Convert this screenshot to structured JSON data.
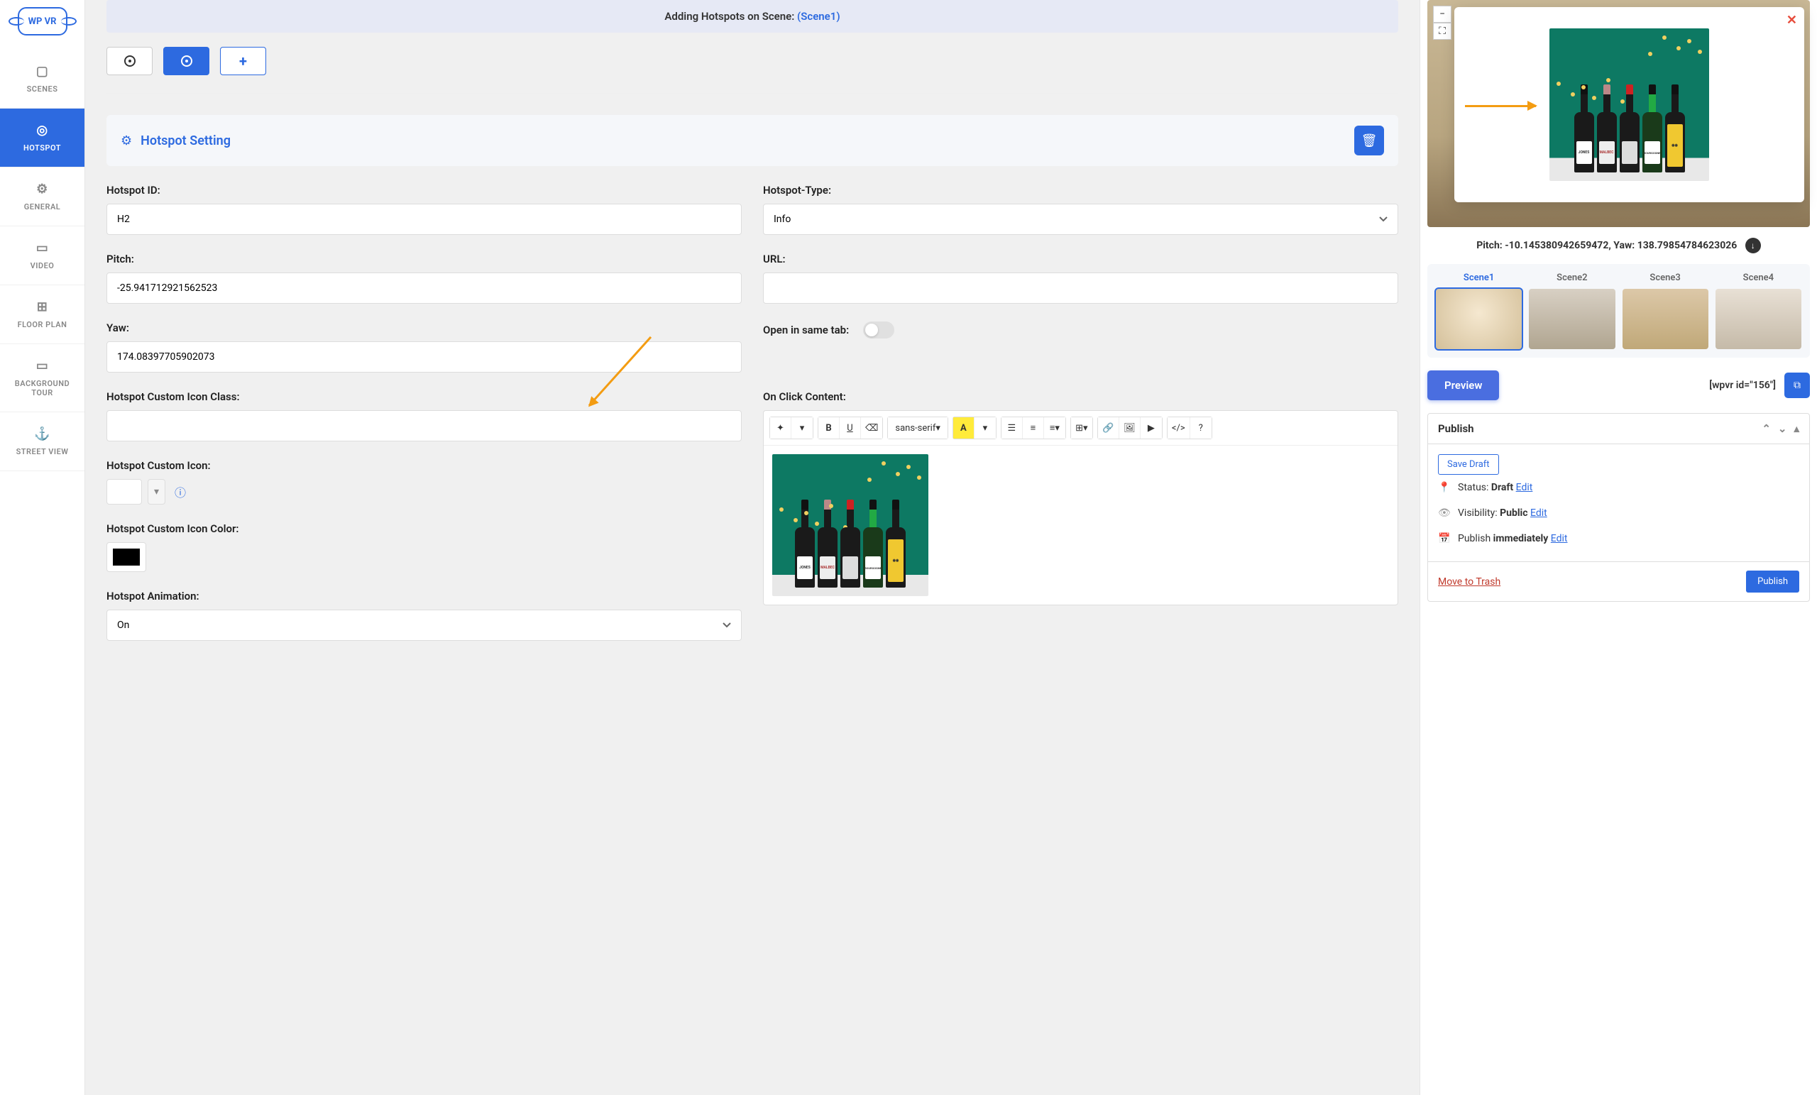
{
  "logo": "WP VR",
  "sidebar": {
    "items": [
      {
        "label": "SCENES",
        "icon": "▢"
      },
      {
        "label": "HOTSPOT",
        "icon": "◎"
      },
      {
        "label": "GENERAL",
        "icon": "⚙"
      },
      {
        "label": "VIDEO",
        "icon": "▭"
      },
      {
        "label": "FLOOR PLAN",
        "icon": "⊞"
      },
      {
        "label": "BACKGROUND TOUR",
        "icon": "▭"
      },
      {
        "label": "STREET VIEW",
        "icon": "⚓"
      }
    ]
  },
  "banner": {
    "prefix": "Adding Hotspots on Scene: ",
    "scene": "(Scene1)"
  },
  "section": {
    "title": "Hotspot Setting"
  },
  "form": {
    "hotspot_id": {
      "label": "Hotspot ID:",
      "value": "H2"
    },
    "hotspot_type": {
      "label": "Hotspot-Type:",
      "value": "Info"
    },
    "pitch": {
      "label": "Pitch:",
      "value": "-25.941712921562523"
    },
    "url": {
      "label": "URL:",
      "value": ""
    },
    "yaw": {
      "label": "Yaw:",
      "value": "174.08397705902073"
    },
    "same_tab": {
      "label": "Open in same tab:"
    },
    "icon_class": {
      "label": "Hotspot Custom Icon Class:",
      "value": ""
    },
    "on_click": {
      "label": "On Click Content:"
    },
    "custom_icon": {
      "label": "Hotspot Custom Icon:"
    },
    "icon_color": {
      "label": "Hotspot Custom Icon Color:"
    },
    "animation": {
      "label": "Hotspot Animation:",
      "value": "On"
    }
  },
  "rte": {
    "font": "sans-serif",
    "highlight": "A"
  },
  "preview": {
    "coords": "Pitch: -10.145380942659472, Yaw: 138.79854784623026",
    "scenes": [
      {
        "label": "Scene1"
      },
      {
        "label": "Scene2"
      },
      {
        "label": "Scene3"
      },
      {
        "label": "Scene4"
      }
    ],
    "preview_btn": "Preview",
    "shortcode": "[wpvr id=\"156\"]"
  },
  "publish": {
    "title": "Publish",
    "save_draft": "Save Draft",
    "status_label": "Status: ",
    "status_value": "Draft",
    "visibility_label": "Visibility: ",
    "visibility_value": "Public",
    "schedule_label": "Publish ",
    "schedule_value": "immediately",
    "edit": "Edit",
    "trash": "Move to Trash",
    "publish_btn": "Publish"
  }
}
